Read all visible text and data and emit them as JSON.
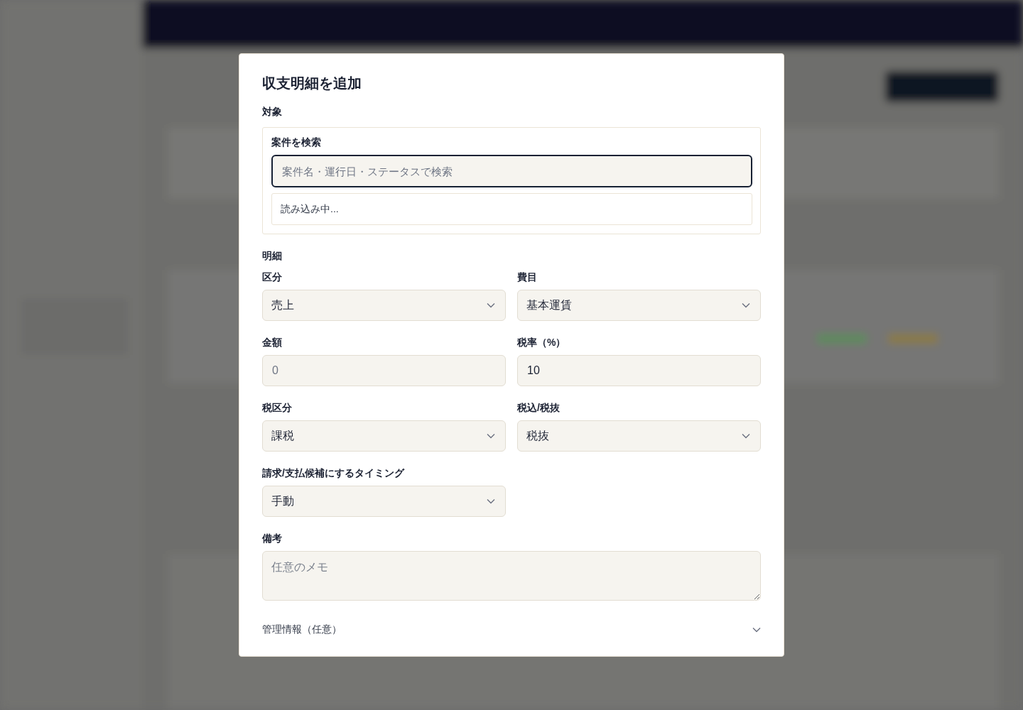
{
  "dialog": {
    "title": "収支明細を追加",
    "target": {
      "heading": "対象",
      "search": {
        "label": "案件を検索",
        "placeholder": "案件名・運行日・ステータスで検索",
        "focused": true
      },
      "results": {
        "message": "読み込み中..."
      }
    },
    "details": {
      "heading": "明細",
      "fields": [
        {
          "kind": "select",
          "label": "区分",
          "value": "売上"
        },
        {
          "kind": "select",
          "label": "費目",
          "value": "基本運賃"
        },
        {
          "kind": "input",
          "label": "金額",
          "placeholder": "0"
        },
        {
          "kind": "input",
          "label": "税率（%）",
          "value": "10"
        },
        {
          "kind": "select",
          "label": "税区分",
          "value": "課税"
        },
        {
          "kind": "select",
          "label": "税込/税抜",
          "value": "税抜"
        },
        {
          "kind": "select",
          "label": "請求/支払候補にするタイミング",
          "value": "手動"
        }
      ]
    },
    "notes": {
      "label": "備考",
      "placeholder": "任意のメモ"
    },
    "admin_section": {
      "label": "管理情報（任意）",
      "expanded": false
    }
  }
}
